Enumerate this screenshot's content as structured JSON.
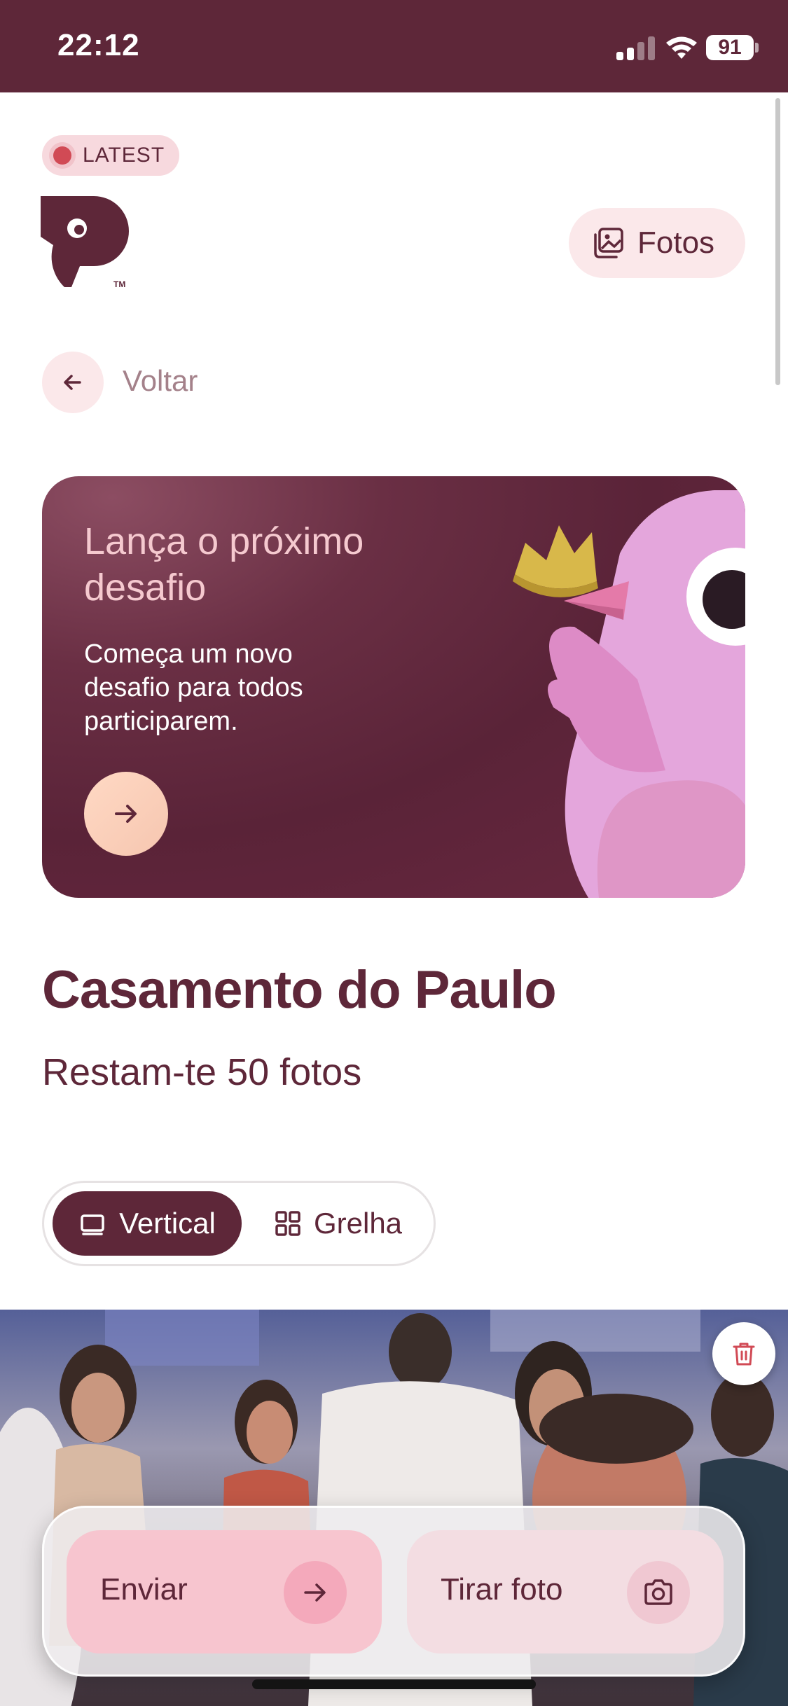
{
  "status_bar": {
    "time": "22:12",
    "battery": "91"
  },
  "header": {
    "badge_label": "LATEST",
    "fotos_button_label": "Fotos"
  },
  "navigation": {
    "back_label": "Voltar"
  },
  "challenge_card": {
    "title": "Lança o próximo desafio",
    "description": "Começa um novo desafio para todos participarem."
  },
  "event": {
    "title": "Casamento do Paulo",
    "subtitle": "Restam-te 50 fotos"
  },
  "view_toggle": {
    "options": [
      "Vertical",
      "Grelha"
    ],
    "selected": "Vertical"
  },
  "actions": {
    "send_label": "Enviar",
    "take_photo_label": "Tirar foto"
  },
  "icons": [
    "signal-icon",
    "wifi-icon",
    "battery-icon",
    "gallery-icon",
    "arrow-left-icon",
    "arrow-right-icon",
    "vertical-view-icon",
    "grid-view-icon",
    "trash-icon",
    "camera-icon"
  ],
  "colors": {
    "brand": "#5e2739",
    "pink_light": "#fbe8ea",
    "accent_red": "#d14a55",
    "card_bg": "#5a2338",
    "title_pink": "#f5c9cf"
  }
}
